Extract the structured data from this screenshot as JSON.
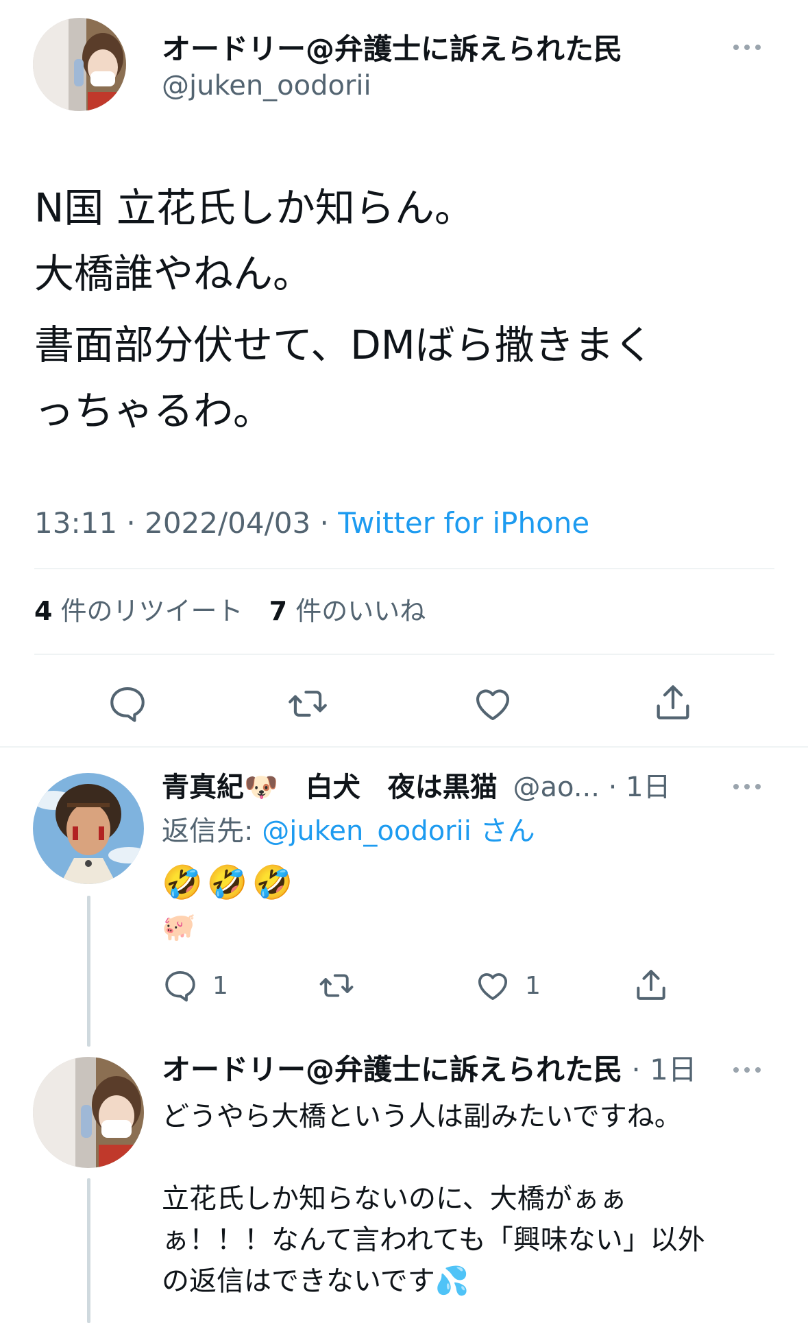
{
  "main_tweet": {
    "display_name": "オードリー@弁護士に訴えられた民",
    "handle": "@juken_oodorii",
    "lines": [
      "N国 立花氏しか知らん。",
      "大橋誰やねん。",
      "書面部分伏せて、DMばら撒きまく",
      "っちゃるわ。"
    ],
    "time": "13:11",
    "date": "2022/04/03",
    "source": "Twitter for iPhone",
    "retweets_count": "4",
    "retweets_label": "件のリツイート",
    "likes_count": "7",
    "likes_label": "件のいいね"
  },
  "reply_1": {
    "display_name": "青真紀🐶　白犬　夜は黒猫",
    "handle": "@ao...",
    "age": "1日",
    "reply_to_label": "返信先:",
    "reply_to_handle": "@juken_oodorii",
    "reply_to_suffix": "さん",
    "line1": "🤣🤣🤣",
    "line2": "🐖",
    "reply_count": "1",
    "like_count": "1"
  },
  "reply_2": {
    "display_name": "オードリー@弁護士に訴えられた民",
    "age": "1日",
    "line1": "どうやら大橋という人は副みたいですね。",
    "line2": "立花氏しか知らないのに、大橋がぁぁ",
    "line3": "ぁ！！！なんて言われても「興味ない」以外",
    "line4": "の返信はできないです💦"
  },
  "sep": " · ",
  "colors": {
    "accent": "#1d9bf0",
    "muted": "#536471",
    "divider": "#eff3f4"
  },
  "icons": [
    "reply-icon",
    "retweet-icon",
    "like-icon",
    "share-icon",
    "more-icon"
  ]
}
